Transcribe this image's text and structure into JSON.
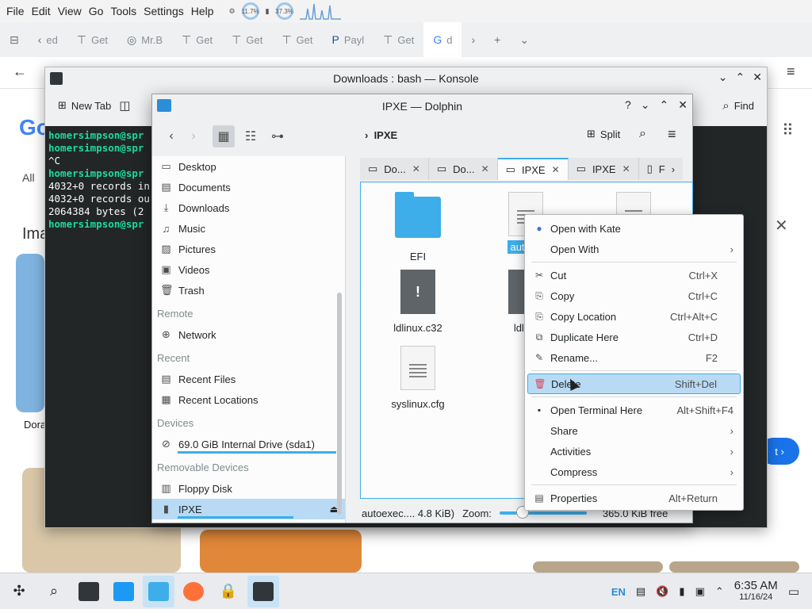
{
  "browser": {
    "menu": [
      "File",
      "Edit",
      "View",
      "Go",
      "Tools",
      "Settings",
      "Help"
    ],
    "tray": {
      "cpu": "11.7%",
      "mem": "37.3%"
    },
    "tabs": [
      "ed",
      "Get",
      "Mr.B",
      "Get",
      "Get",
      "Get",
      "Payl",
      "Get",
      "d"
    ],
    "bg": {
      "google": "Go",
      "all": "All",
      "images": "Ima",
      "dora": "Dora",
      "next": "t"
    }
  },
  "konsole": {
    "title": "Downloads : bash — Konsole",
    "new_tab": "New Tab",
    "find": "Find",
    "lines": [
      {
        "prompt": "homersimpson@spr",
        "text": ""
      },
      {
        "prompt": "homersimpson@spr",
        "text": ""
      },
      {
        "prompt": "",
        "text": "^C"
      },
      {
        "prompt": "homersimpson@spr",
        "text": ""
      },
      {
        "prompt": "",
        "text": "4032+0 records in"
      },
      {
        "prompt": "",
        "text": "4032+0 records ou"
      },
      {
        "prompt": "",
        "text": "2064384 bytes (2"
      },
      {
        "prompt": "homersimpson@spr",
        "text": ""
      }
    ]
  },
  "dolphin": {
    "title": "IPXE — Dolphin",
    "breadcrumb": "IPXE",
    "split": "Split",
    "places": {
      "main": [
        "Desktop",
        "Documents",
        "Downloads",
        "Music",
        "Pictures",
        "Videos",
        "Trash"
      ],
      "remote_header": "Remote",
      "remote": [
        "Network"
      ],
      "recent_header": "Recent",
      "recent": [
        "Recent Files",
        "Recent Locations"
      ],
      "devices_header": "Devices",
      "devices": [
        "69.0 GiB Internal Drive (sda1)"
      ],
      "removable_header": "Removable Devices",
      "removable": [
        "Floppy Disk",
        "IPXE"
      ]
    },
    "tabs": [
      "Do...",
      "Do...",
      "IPXE",
      "IPXE",
      "F"
    ],
    "files": [
      {
        "name": "EFI",
        "kind": "folder"
      },
      {
        "name": "autoex",
        "kind": "doc"
      },
      {
        "name": "ldlinux.c32",
        "kind": "bin"
      },
      {
        "name": "ldlinu",
        "kind": "bin"
      },
      {
        "name": "syslinux.cfg",
        "kind": "doc"
      }
    ],
    "status": {
      "selection": "autoexec.... 4.8 KiB)",
      "zoom_label": "Zoom:",
      "free": "365.0 KiB free",
      "zoom_level": 0.22
    }
  },
  "context_menu": {
    "groups": [
      [
        {
          "label": "Open with Kate",
          "shortcut": "",
          "submenu": false,
          "icon": "kate-icon"
        },
        {
          "label": "Open With",
          "shortcut": "",
          "submenu": true,
          "icon": ""
        }
      ],
      [
        {
          "label": "Cut",
          "shortcut": "Ctrl+X",
          "submenu": false,
          "icon": "cut-icon"
        },
        {
          "label": "Copy",
          "shortcut": "Ctrl+C",
          "submenu": false,
          "icon": "copy-icon"
        },
        {
          "label": "Copy Location",
          "shortcut": "Ctrl+Alt+C",
          "submenu": false,
          "icon": "copy-location-icon"
        },
        {
          "label": "Duplicate Here",
          "shortcut": "Ctrl+D",
          "submenu": false,
          "icon": "duplicate-icon"
        },
        {
          "label": "Rename...",
          "shortcut": "F2",
          "submenu": false,
          "icon": "rename-icon"
        }
      ],
      [
        {
          "label": "Delete",
          "shortcut": "Shift+Del",
          "submenu": false,
          "icon": "trash-icon",
          "highlighted": true
        }
      ],
      [
        {
          "label": "Open Terminal Here",
          "shortcut": "Alt+Shift+F4",
          "submenu": false,
          "icon": "terminal-icon"
        },
        {
          "label": "Share",
          "shortcut": "",
          "submenu": true,
          "icon": ""
        },
        {
          "label": "Activities",
          "shortcut": "",
          "submenu": true,
          "icon": ""
        },
        {
          "label": "Compress",
          "shortcut": "",
          "submenu": true,
          "icon": ""
        }
      ],
      [
        {
          "label": "Properties",
          "shortcut": "Alt+Return",
          "submenu": false,
          "icon": "properties-icon"
        }
      ]
    ]
  },
  "taskbar": {
    "lang": "EN",
    "time": "6:35 AM",
    "date": "11/16/24"
  },
  "colors": {
    "accent": "#3daee9",
    "terminal_bg": "#232627",
    "prompt": "#1cdc9a"
  }
}
